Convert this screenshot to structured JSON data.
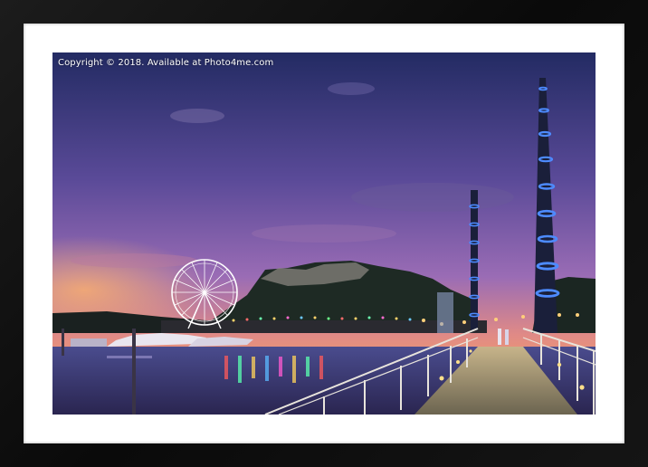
{
  "photo": {
    "copyright_text": "Copyright ©   2018. Available at Photo4me.com"
  },
  "colors": {
    "frame": "#0d0d0d",
    "mount": "#ffffff",
    "sky_top": "#2b3470",
    "sky_mid": "#7a5fb0",
    "sky_horizon": "#f39a6a",
    "pole_light": "#3f7bff"
  }
}
